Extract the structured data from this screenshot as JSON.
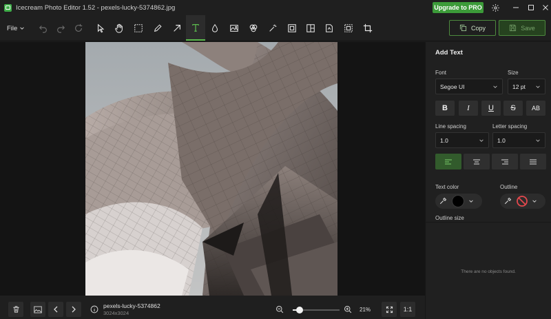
{
  "window": {
    "title": "Icecream Photo Editor 1.52 - pexels-lucky-5374862.jpg",
    "upgrade_label": "Upgrade to PRO",
    "controls": [
      "minimize-icon",
      "maximize-icon",
      "close-icon"
    ]
  },
  "toolbar": {
    "file_label": "File",
    "history_tools": [
      "undo-icon",
      "redo-icon",
      "reset-icon"
    ],
    "tools": [
      {
        "name": "select-tool",
        "icon": "pointer-icon",
        "active": false
      },
      {
        "name": "hand-tool",
        "icon": "hand-icon",
        "active": false
      },
      {
        "name": "marquee-tool",
        "icon": "dashed-rect-icon",
        "active": false
      },
      {
        "name": "pencil-tool",
        "icon": "pencil-icon",
        "active": false
      },
      {
        "name": "arrow-tool",
        "icon": "arrow-icon",
        "active": false
      },
      {
        "name": "text-tool",
        "icon": "text-icon",
        "active": true
      },
      {
        "name": "blur-tool",
        "icon": "drop-icon",
        "active": false
      },
      {
        "name": "image-tool",
        "icon": "image-icon",
        "active": false
      },
      {
        "name": "filter-tool",
        "icon": "filter-icon",
        "active": false
      },
      {
        "name": "magic-tool",
        "icon": "magic-wand-icon",
        "active": false
      },
      {
        "name": "resize-tool",
        "icon": "resize-icon",
        "active": false
      },
      {
        "name": "collage-tool",
        "icon": "collage-icon",
        "active": false
      },
      {
        "name": "watermark-tool",
        "icon": "watermark-icon",
        "active": false
      },
      {
        "name": "select-area-tool",
        "icon": "select-area-icon",
        "active": false
      },
      {
        "name": "crop-tool",
        "icon": "crop-icon",
        "active": false
      }
    ],
    "copy_label": "Copy",
    "save_label": "Save"
  },
  "panel": {
    "title": "Add Text",
    "font_label": "Font",
    "font_value": "Segoe UI",
    "size_label": "Size",
    "size_value": "12 pt",
    "style_buttons": [
      {
        "name": "bold-button",
        "glyph": "B"
      },
      {
        "name": "italic-button",
        "glyph": "I"
      },
      {
        "name": "underline-button",
        "glyph": "U"
      },
      {
        "name": "strikethrough-button",
        "glyph": "S"
      },
      {
        "name": "uppercase-button",
        "glyph": "AB"
      }
    ],
    "line_spacing_label": "Line spacing",
    "line_spacing_value": "1.0",
    "letter_spacing_label": "Letter spacing",
    "letter_spacing_value": "1.0",
    "alignments": [
      "align-left",
      "align-center",
      "align-right",
      "align-justify"
    ],
    "active_alignment": "align-left",
    "text_color_label": "Text color",
    "text_color": "#000000",
    "outline_label": "Outline",
    "outline_color": "none",
    "outline_size_label": "Outline size",
    "empty_message": "There are no objects found."
  },
  "statusbar": {
    "file_name": "pexels-lucky-5374862",
    "file_dimensions": "3024x3024",
    "zoom_level": "21%",
    "zoom_fraction": 0.15,
    "one_to_one_label": "1:1"
  },
  "colors": {
    "accent_green": "#5cbc4e",
    "upgrade_green": "#3c9b39",
    "panel_bg": "#202020",
    "canvas_bg": "#141414"
  }
}
